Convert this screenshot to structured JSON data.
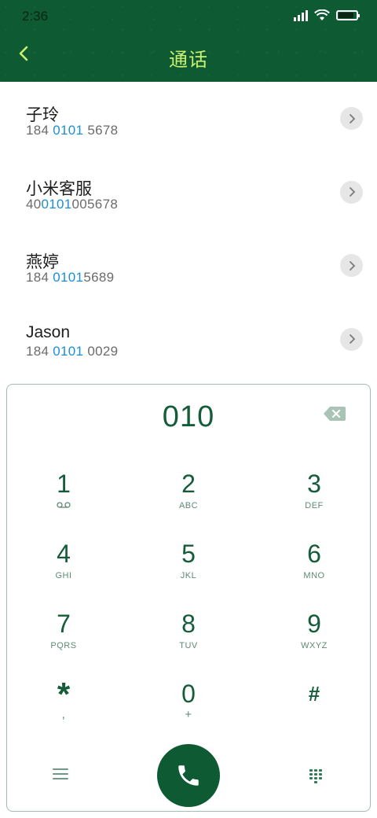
{
  "status_bar": {
    "time": "2:36",
    "icons": [
      "signal-icon",
      "wifi-icon",
      "battery-icon"
    ]
  },
  "header": {
    "title": "通话",
    "back_icon": "chevron-left-icon",
    "accent_color": "#c8f06e",
    "bg_color": "#0e5a32"
  },
  "contacts": [
    {
      "name": "子玲",
      "number_pre": "184 ",
      "number_match": "0101",
      "number_post": " 5678"
    },
    {
      "name": "小米客服",
      "number_pre": "40",
      "number_match": "0101",
      "number_post": "005678"
    },
    {
      "name": "燕婷",
      "number_pre": "184 ",
      "number_match": "0101",
      "number_post": "5689"
    },
    {
      "name": "Jason",
      "number_pre": "184 ",
      "number_match": "0101",
      "number_post": " 0029"
    }
  ],
  "dialpad": {
    "display": "010",
    "keys": [
      {
        "digit": "1",
        "letters": ""
      },
      {
        "digit": "2",
        "letters": "ABC"
      },
      {
        "digit": "3",
        "letters": "DEF"
      },
      {
        "digit": "4",
        "letters": "GHI"
      },
      {
        "digit": "5",
        "letters": "JKL"
      },
      {
        "digit": "6",
        "letters": "MNO"
      },
      {
        "digit": "7",
        "letters": "PQRS"
      },
      {
        "digit": "8",
        "letters": "TUV"
      },
      {
        "digit": "9",
        "letters": "WXYZ"
      },
      {
        "digit": "*",
        "letters": ","
      },
      {
        "digit": "0",
        "letters": "+"
      },
      {
        "digit": "#",
        "letters": ""
      }
    ],
    "bottom_icons": [
      "menu-icon",
      "phone-icon",
      "keypad-icon"
    ],
    "highlight_color": "#1a8fd6"
  }
}
